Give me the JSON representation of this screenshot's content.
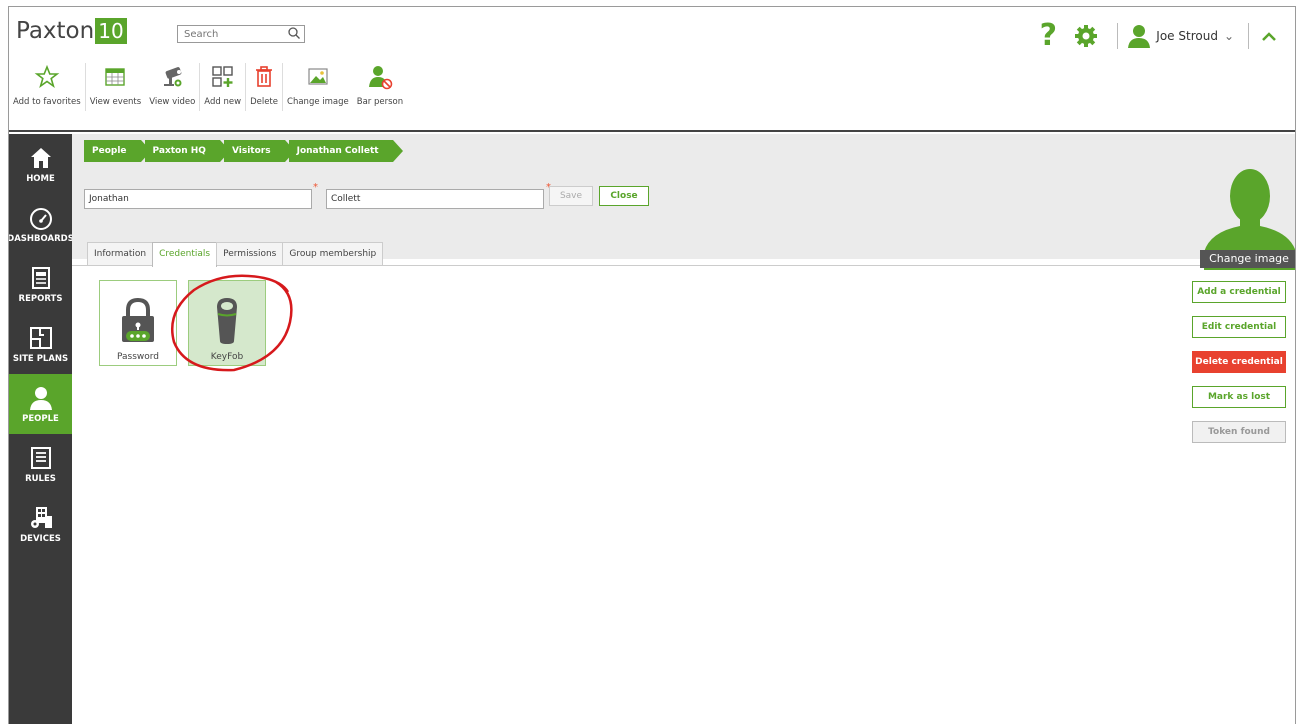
{
  "app": {
    "name": "Paxton",
    "version": "10"
  },
  "search": {
    "placeholder": "Search"
  },
  "user": {
    "name": "Joe Stroud"
  },
  "toolbar": [
    {
      "label": "Add to favorites",
      "icon": "star-icon"
    },
    {
      "label": "View events",
      "icon": "calendar-icon"
    },
    {
      "label": "View video",
      "icon": "camera-icon"
    },
    {
      "label": "Add new",
      "icon": "add-new-icon"
    },
    {
      "label": "Delete",
      "icon": "trash-icon"
    },
    {
      "label": "Change image",
      "icon": "image-icon"
    },
    {
      "label": "Bar person",
      "icon": "bar-person-icon"
    }
  ],
  "sidebar": [
    {
      "label": "HOME",
      "icon": "home-icon"
    },
    {
      "label": "DASHBOARDS",
      "icon": "dashboard-icon"
    },
    {
      "label": "REPORTS",
      "icon": "report-icon"
    },
    {
      "label": "SITE PLANS",
      "icon": "site-plan-icon"
    },
    {
      "label": "PEOPLE",
      "icon": "person-icon",
      "active": true
    },
    {
      "label": "RULES",
      "icon": "rules-icon"
    },
    {
      "label": "DEVICES",
      "icon": "devices-icon"
    }
  ],
  "breadcrumb": [
    "People",
    "Paxton HQ",
    "Visitors",
    "Jonathan Collett"
  ],
  "person": {
    "first_name": "Jonathan",
    "last_name": "Collett"
  },
  "buttons": {
    "save": "Save",
    "close": "Close",
    "change_image": "Change image"
  },
  "tabs": [
    "Information",
    "Credentials",
    "Permissions",
    "Group membership"
  ],
  "active_tab": "Credentials",
  "credentials": [
    {
      "label": "Password",
      "icon": "password-lock-icon"
    },
    {
      "label": "KeyFob",
      "icon": "keyfob-icon",
      "selected": true
    }
  ],
  "actions": [
    "Add a credential",
    "Edit credential",
    "Delete credential",
    "Mark as lost",
    "Token found"
  ],
  "colors": {
    "brand_green": "#5aa52b",
    "sidebar": "#3a3a3a",
    "danger": "#e8412f"
  }
}
